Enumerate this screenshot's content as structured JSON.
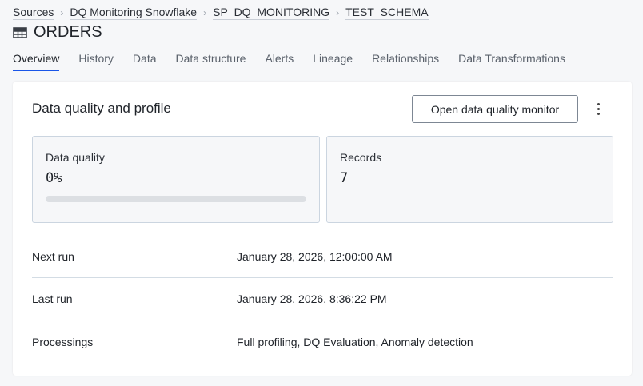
{
  "breadcrumb": [
    "Sources",
    "DQ Monitoring Snowflake",
    "SP_DQ_MONITORING",
    "TEST_SCHEMA"
  ],
  "title": "ORDERS",
  "tabs": [
    "Overview",
    "History",
    "Data",
    "Data structure",
    "Alerts",
    "Lineage",
    "Relationships",
    "Data Transformations"
  ],
  "card": {
    "title": "Data quality and profile",
    "open_button": "Open data quality monitor",
    "quality": {
      "label": "Data quality",
      "value": "0%",
      "progress_percent": 0
    },
    "records": {
      "label": "Records",
      "value": "7"
    },
    "rows": [
      {
        "label": "Next run",
        "value": "January 28, 2026, 12:00:00 AM"
      },
      {
        "label": "Last run",
        "value": "January 28, 2026, 8:36:22 PM"
      },
      {
        "label": "Processings",
        "value": "Full profiling, DQ Evaluation, Anomaly detection"
      }
    ]
  },
  "colors": {
    "accent": "#1a56e8"
  }
}
